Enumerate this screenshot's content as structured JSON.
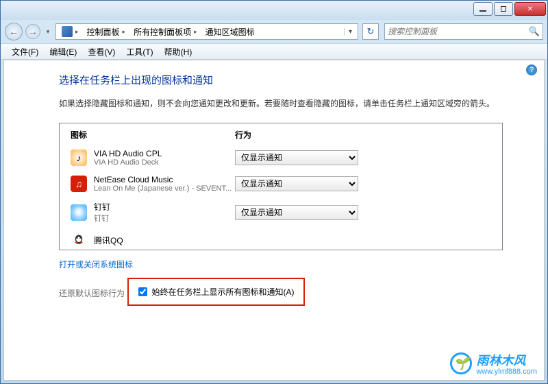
{
  "titlebar": {},
  "breadcrumb": {
    "seg1": "控制面板",
    "seg2": "所有控制面板项",
    "seg3": "通知区域图标"
  },
  "search": {
    "placeholder": "搜索控制面板"
  },
  "menu": {
    "file": "文件(F)",
    "edit": "编辑(E)",
    "view": "查看(V)",
    "tools": "工具(T)",
    "help": "帮助(H)"
  },
  "page": {
    "title": "选择在任务栏上出现的图标和通知",
    "desc": "如果选择隐藏图标和通知，则不会向您通知更改和更新。若要随时查看隐藏的图标，请单击任务栏上通知区域旁的箭头。"
  },
  "headers": {
    "icon": "图标",
    "action": "行为"
  },
  "options": {
    "notify_only": "仅显示通知"
  },
  "items": [
    {
      "name": "VIA HD Audio CPL",
      "sub": "VIA HD Audio Deck",
      "icon": "via"
    },
    {
      "name": "NetEase Cloud Music",
      "sub": "Lean On Me (Japanese ver.) - SEVENT...",
      "icon": "net"
    },
    {
      "name": "钉钉",
      "sub": "钉钉",
      "icon": "ding"
    },
    {
      "name": "腾讯QQ",
      "sub": "",
      "icon": "qq"
    }
  ],
  "links": {
    "system_icons": "打开或关闭系统图标",
    "restore_default": "还原默认图标行为"
  },
  "checkbox": {
    "label": "始终在任务栏上显示所有图标和通知(A)",
    "checked": true
  },
  "watermark": {
    "text": "雨林木风",
    "url": "www.ylmf888.com"
  }
}
